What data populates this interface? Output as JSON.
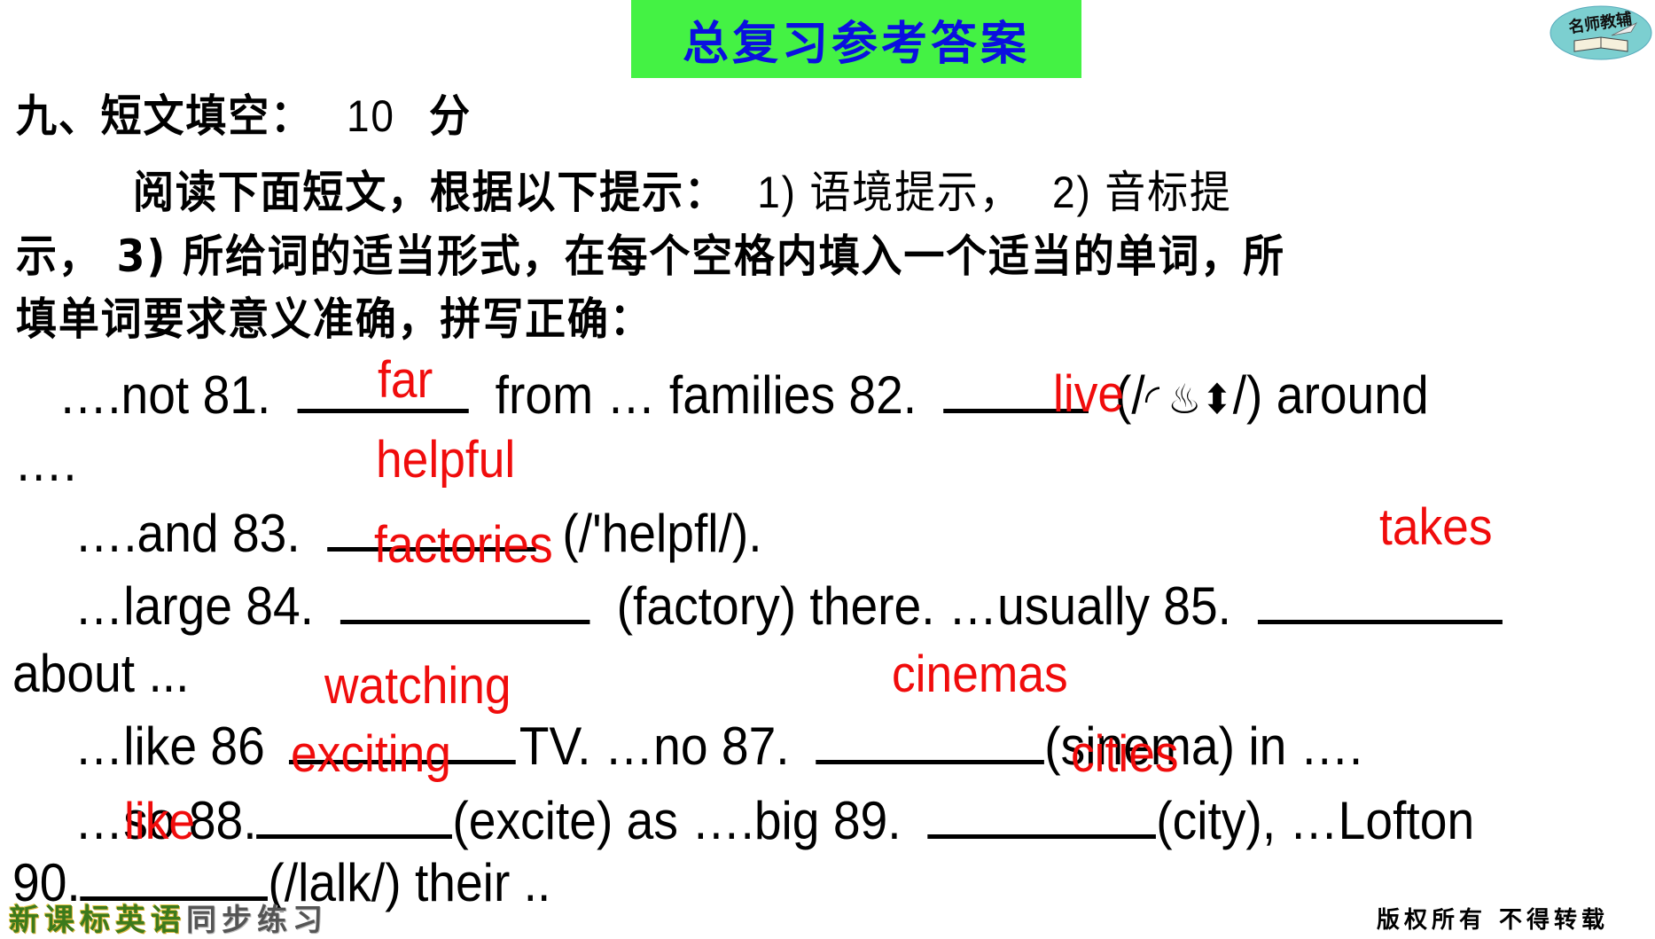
{
  "header": {
    "title": "总复习参考答案",
    "logo_text": "名师教辅"
  },
  "section": {
    "heading": "九、短文填空：",
    "score": "10",
    "score_unit": "分"
  },
  "instructions": {
    "line1": "阅读下面短文，根据以下提示：",
    "line1_b": "1) 语境提示，",
    "line1_c": "2) 音标提",
    "line2": "示， 3) 所给词的适当形式，在每个空格内填入一个适当的单词，所",
    "line3": "填单词要求意义准确，拼写正确："
  },
  "passage": {
    "l1_a": "….not  81.",
    "l1_b": "from … families 82.",
    "l1_c": "(/",
    "l1_glyph1": "◜",
    "l1_glyph2": "♨",
    "l1_glyph3": "⬍",
    "l1_d": "/)  around",
    "l2_a": "….",
    "l3_a": "….and 83.",
    "l3_b": "(/'helpfl/).",
    "l4_a": "…large 84.",
    "l4_b": "(factory) there. …usually 85.",
    "l5_a": "about ...",
    "l6_a": "…like 86",
    "l6_b": "TV. …no 87.",
    "l6_c": "(sinema) in ….",
    "l7_a": "…so 88.",
    "l7_b": "(excite) as ….big 89.",
    "l7_c": "(city), …Lofton",
    "l8_a": "90.",
    "l8_b": "(/lalk/) their .."
  },
  "answers": {
    "a81": "far",
    "a82": "live",
    "a83": "helpful",
    "a84": "factories",
    "a85": "takes",
    "a86": "watching",
    "a87": "cinemas",
    "a88": "exciting",
    "a89": "cities",
    "a90": "like"
  },
  "footer": {
    "left_green": "新课标英语",
    "left_gray": "同步练习",
    "right": "版权所有 不得转载"
  },
  "colors": {
    "title_bg": "#44f244",
    "title_text": "#0a10e0",
    "answer": "#f00c0c"
  }
}
